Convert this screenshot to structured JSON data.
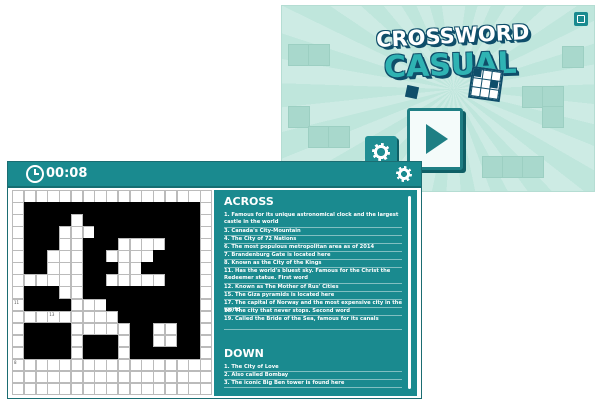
{
  "title_screen": {
    "logo_line1": "CROSSWORD",
    "logo_line2": "CASUAL",
    "play_icon": "play-icon",
    "settings_icon": "gear-icon",
    "fullscreen_icon": "fullscreen-icon",
    "bg_color": "#bfe6dc",
    "accent_color": "#1f8e93"
  },
  "game": {
    "timer": "00:08",
    "clock_icon": "clock-icon",
    "settings_icon": "gear-icon",
    "bar_color": "#1a8a8f",
    "grid": {
      "rows": 17,
      "cols": 17,
      "black_rows": [
        "00000000000000000",
        "01111111111111110",
        "01111011111111110",
        "01110001111111110",
        "01110011100001110",
        "01100011000011110",
        "01100011100111110",
        "00000011000001110",
        "01110011111111110",
        "01111000111111110",
        "00000000011111110",
        "01111000001100110",
        "01111011101100110",
        "01111011101111110",
        "00000000000000000",
        "00000000000000000",
        "00000000000000000"
      ],
      "numbers": [
        {
          "r": 9,
          "c": 0,
          "n": "11"
        },
        {
          "r": 10,
          "c": 3,
          "n": "13"
        },
        {
          "r": 9,
          "c": 8,
          "n": "8"
        },
        {
          "r": 10,
          "c": 11,
          "n": "14"
        },
        {
          "r": 14,
          "c": 0,
          "n": "8"
        }
      ]
    },
    "clues": {
      "across_title": "ACROSS",
      "across": [
        "1. Famous for its unique astronomical clock and the largest castle in the world",
        "3. Canada's City-Mountain",
        "4. The City of 72 Nations",
        "6. The most populous metropolitan area as of 2014",
        "7. Brandenburg Gate is located here",
        "8. Known as the City of the Kings",
        "11. Has the world's bluest sky. Famous for the Christ the Redeemer statue. First word",
        "12. Known as The Mother of Rus' Cities",
        "15. The Giza pyramids is located here",
        "17. The capital of Norway and the most expensive city in the world",
        "18. The city that never stops. Second word",
        "19. Called the Bride of the Sea, famous for its canals"
      ],
      "down_title": "DOWN",
      "down": [
        "1. The City of Love",
        "2. Also called Bombay",
        "3. The iconic Big Ben tower is found here"
      ]
    },
    "panel_color": "#1a8a8f"
  }
}
